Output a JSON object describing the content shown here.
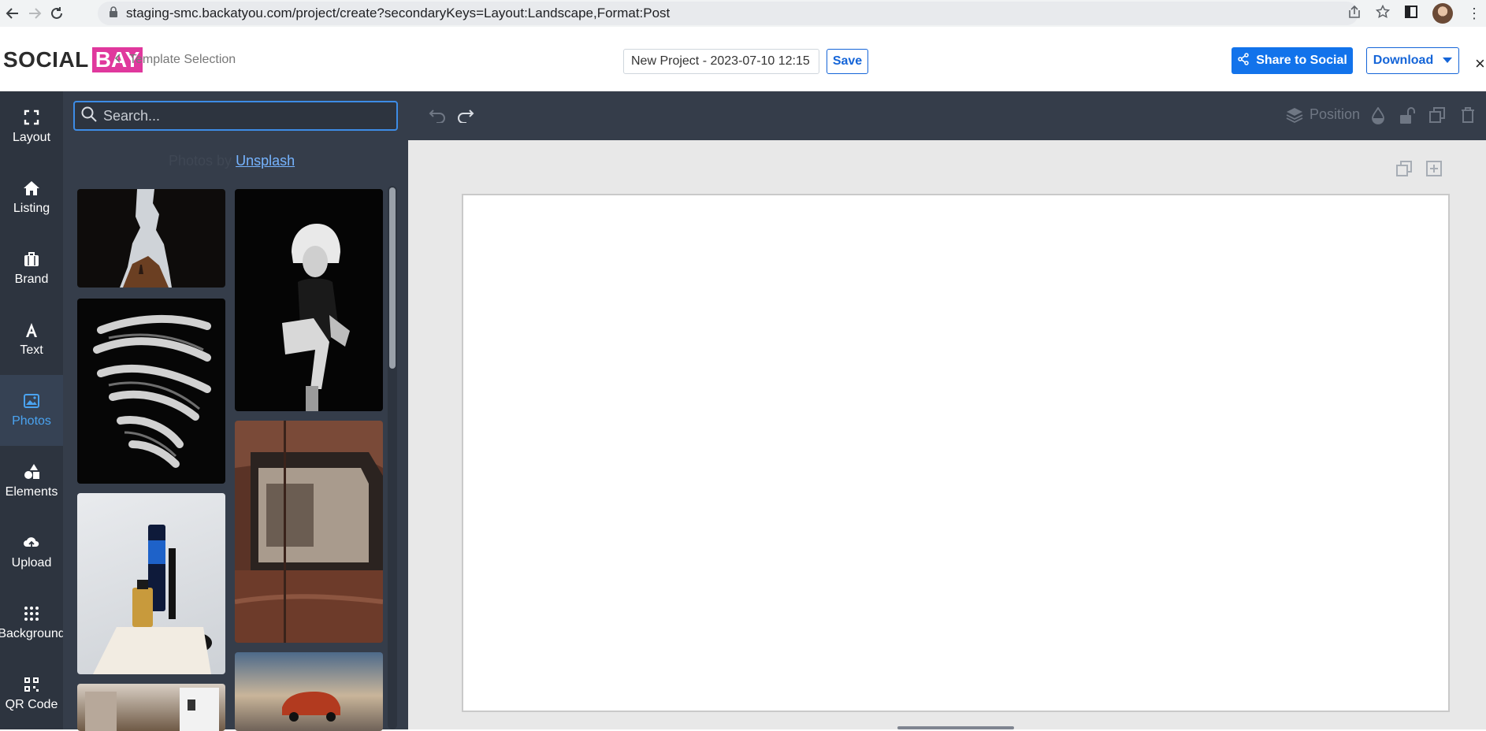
{
  "browser": {
    "url": "staging-smc.backatyou.com/project/create?secondaryKeys=Layout:Landscape,Format:Post"
  },
  "header": {
    "logo_part1": "SOCIAL",
    "logo_part2": "BAY",
    "breadcrumb": "Template Selection",
    "project_name": "New Project - 2023-07-10 12:15",
    "save_label": "Save",
    "share_label": "Share to Social",
    "download_label": "Download",
    "close_label": "×"
  },
  "rail": {
    "items": [
      {
        "label": "Layout",
        "icon": "fullscreen-icon"
      },
      {
        "label": "Listing",
        "icon": "home-icon"
      },
      {
        "label": "Brand",
        "icon": "briefcase-icon"
      },
      {
        "label": "Text",
        "icon": "text-icon"
      },
      {
        "label": "Photos",
        "icon": "image-icon",
        "active": true
      },
      {
        "label": "Elements",
        "icon": "shapes-icon"
      },
      {
        "label": "Upload",
        "icon": "cloud-upload-icon"
      },
      {
        "label": "Background",
        "icon": "dots-grid-icon"
      },
      {
        "label": "QR Code",
        "icon": "qr-code-icon"
      }
    ]
  },
  "panel": {
    "search_placeholder": "Search...",
    "credit_prefix": "Photos by",
    "credit_link": "Unsplash"
  },
  "toolbar": {
    "position_label": "Position"
  },
  "colors": {
    "brand_pink": "#e0389d",
    "primary_blue": "#1273eb",
    "rail_bg": "#2d343f",
    "panel_bg": "#353d4a",
    "active_accent": "#4aa3f0"
  }
}
